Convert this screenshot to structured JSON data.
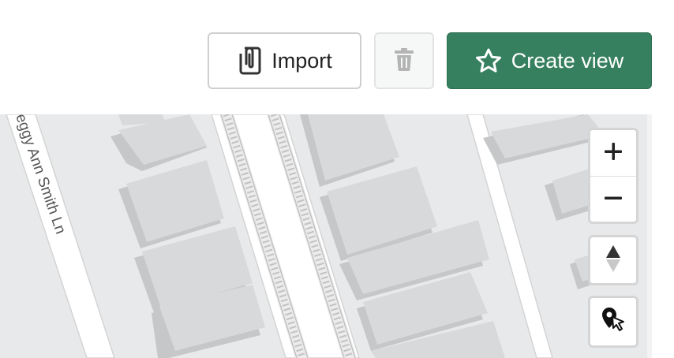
{
  "toolbar": {
    "import_label": "Import",
    "create_view_label": "Create view"
  },
  "map": {
    "street_label": "eggy Ann Smith Ln"
  },
  "colors": {
    "accent": "#37805f",
    "map_background": "#e8e9ea",
    "building": "#d8d9da",
    "building_shadow": "#c6c7c8",
    "road": "#ffffff"
  },
  "icons": {
    "import": "paperclip-document-icon",
    "delete": "trash-icon",
    "create_view": "star-outline-icon",
    "zoom_in": "plus-icon",
    "zoom_out": "minus-icon",
    "compass": "compass-arrows-icon",
    "select": "pin-cursor-icon"
  }
}
